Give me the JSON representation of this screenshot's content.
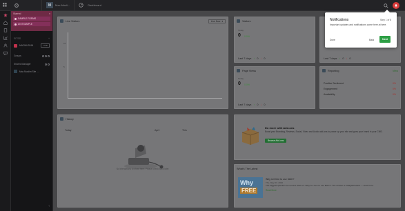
{
  "topbar": {
    "site_initial": "M",
    "site_name": "Mac Musli...",
    "page_name": "Dashboard"
  },
  "sidebar": {
    "pinned": {
      "heading": "Starred",
      "items": [
        "SAMPLE FORMS",
        "AN EXAMPLE"
      ]
    },
    "sites_heading": "SITES",
    "sites_item": "MACMUSLIM",
    "sites_tag": "LIVE",
    "groups_heading": "Groups",
    "shared_heading": "Shared Manager",
    "shared_item": "Mac Muslim Site ...."
  },
  "live_visitors": {
    "title": "Live Visitors",
    "range_label": "Live Now",
    "ticks": [
      "10",
      "",
      "5",
      ""
    ]
  },
  "visitors": {
    "title": "Visitors",
    "sub": "Today",
    "value": "0",
    "delta": "0.0%",
    "footer_label": "Last 7 days",
    "footer_up": "0",
    "footer_down": "0"
  },
  "page_views": {
    "title": "Page Views",
    "sub": "Today",
    "value": "0",
    "delta": "0.0%",
    "footer_label": "Last 7 days",
    "footer_up": "0",
    "footer_down": "0"
  },
  "third_stat": {
    "footer_label": "Last 7 days",
    "footer_up": "0",
    "footer_down": "0"
  },
  "reporting": {
    "title": "Reporting",
    "link": "View",
    "rows": [
      {
        "label": "Positive Sentiment",
        "value": "0%"
      },
      {
        "label": "Engagement",
        "value": "0%"
      },
      {
        "label": "Availability",
        "value": "0%"
      }
    ]
  },
  "history": {
    "title": "History",
    "columns": [
      "Today",
      "April",
      "This"
    ],
    "empty_text": "No interactions to show here. Please check back later."
  },
  "addons": {
    "title": "Do more with Add-ons",
    "text": "Boost your Branding, Reviews, Social, Video and Audio add-ons to power up your site and grow your brand in your CMS.",
    "button": "Browse Add-ons"
  },
  "whats_new": {
    "title": "What's The Latest",
    "image_line1": "Why",
    "image_line2": "FREE",
    "post_title": "Why is it free to use MAC?",
    "post_date": "Thu, May 07, 2020",
    "post_text": "The biggest question we receive asks us \"Why is it free to use MAC?\" The answer is straightforward — read more.",
    "read_more": "Read More"
  },
  "notification": {
    "title": "Notifications",
    "step": "Step 1 of 8",
    "text": "Important updates and notifications come here at here.",
    "done": "Done",
    "back": "Back",
    "next": "Next"
  },
  "colors": {
    "accent": "#c94566",
    "next_button": "#2d9f45",
    "alert": "#d93b3b"
  }
}
